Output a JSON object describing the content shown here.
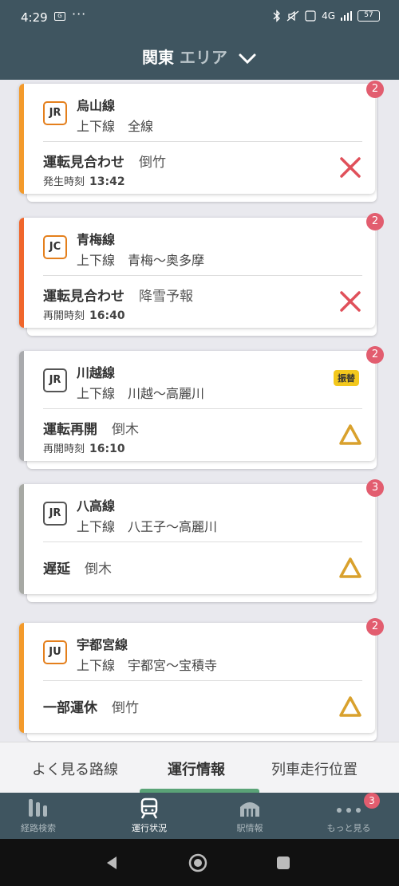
{
  "status_bar": {
    "time": "4:29",
    "mini_icon": "G",
    "dots": "···",
    "network": "4G",
    "battery": "57"
  },
  "header": {
    "area_main": "関東",
    "area_suffix": "エリア"
  },
  "colors": {
    "header_bg": "#3f5560",
    "jr_orange": "#f39a2b",
    "ome_orange": "#f0662c",
    "kawagoe_gray": "#a9aaad",
    "hachiko_gray": "#a7a9a4",
    "badge_pink": "#e25d6f",
    "cross_red": "#e0505a",
    "warn_orange": "#d9a12d",
    "active_green": "#5aa377"
  },
  "cards": [
    {
      "badge": "2",
      "logo": "JR",
      "line": "烏山線",
      "section": "上下線　全線",
      "status": "運転見合わせ",
      "cause": "倒竹",
      "time_label": "発生時刻",
      "time": "13:42",
      "mark": "cross-icon"
    },
    {
      "badge": "2",
      "logo": "JC",
      "line": "青梅線",
      "section": "上下線　青梅〜奥多摩",
      "status": "運転見合わせ",
      "cause": "降雪予報",
      "time_label": "再開時刻",
      "time": "16:40",
      "mark": "cross-icon"
    },
    {
      "badge": "2",
      "logo": "JR",
      "line": "川越線",
      "section": "上下線　川越〜高麗川",
      "status": "運転再開",
      "cause": "倒木",
      "time_label": "再開時刻",
      "time": "16:10",
      "tag": "振替",
      "mark": "warning-triangle-icon"
    },
    {
      "badge": "3",
      "logo": "JR",
      "line": "八高線",
      "section": "上下線　八王子〜高麗川",
      "status": "遅延",
      "cause": "倒木",
      "mark": "warning-triangle-icon"
    },
    {
      "badge": "2",
      "logo": "JU",
      "line": "宇都宮線",
      "section": "上下線　宇都宮〜宝積寺",
      "status": "一部運休",
      "cause": "倒竹",
      "mark": "warning-triangle-icon"
    }
  ],
  "segments": [
    {
      "label": "よく見る路線"
    },
    {
      "label": "運行情報"
    },
    {
      "label": "列車走行位置"
    }
  ],
  "nav": {
    "items": [
      {
        "label": "経路検索"
      },
      {
        "label": "運行状況"
      },
      {
        "label": "駅情報"
      },
      {
        "label": "もっと見る"
      }
    ],
    "more_badge": "3"
  }
}
